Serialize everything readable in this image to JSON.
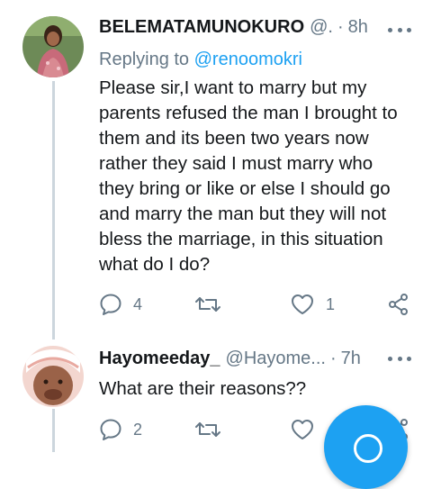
{
  "tweets": [
    {
      "name": "BELEMATAMUNOKURO",
      "handle": "@.",
      "separator": "·",
      "time": "8h",
      "replying_prefix": "Replying to",
      "replying_handle": "@renoomokri",
      "lines": [
        "Please sir,I want to marry but my",
        "parents refused the man I brought to",
        "them and its been two years now",
        "rather they said I must marry who",
        "they bring or like or else I should go",
        "and marry the man but they will not",
        "bless the marriage, in this situation",
        "what do I do?"
      ],
      "reply_count": "4",
      "retweet_count": "",
      "like_count": "1"
    },
    {
      "name": "Hayomeeday_",
      "handle": "@Hayome...",
      "separator": "·",
      "time": "7h",
      "lines": [
        "What are their reasons??"
      ],
      "reply_count": "2",
      "retweet_count": "",
      "like_count": ""
    }
  ],
  "icons": {
    "reply": "reply-icon",
    "retweet": "retweet-icon",
    "like": "heart-icon",
    "share": "share-icon",
    "more": "more-icon",
    "compose": "compose-fab"
  },
  "colors": {
    "accent": "#1da1f2",
    "secondary_text": "#657786",
    "primary_text": "#14171a",
    "thread_line": "#ccd6dd"
  }
}
